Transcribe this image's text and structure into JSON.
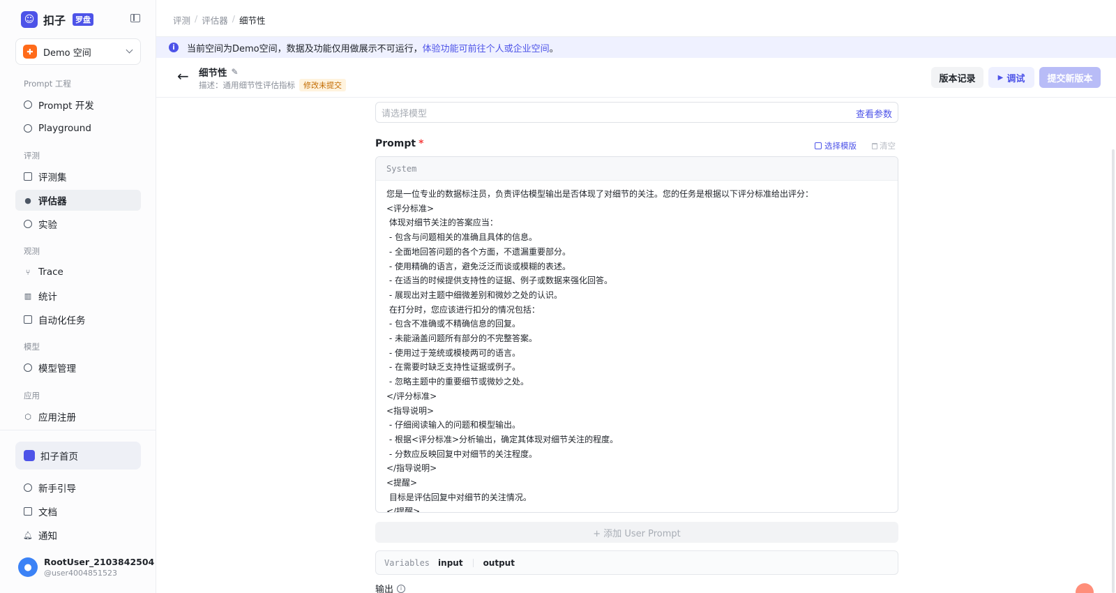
{
  "app": {
    "logo_text": "扣子",
    "logo_badge": "罗盘"
  },
  "space": {
    "name": "Demo 空间",
    "icon": "grid-icon"
  },
  "sidebar": {
    "groups": [
      {
        "label": "Prompt 工程",
        "items": [
          {
            "label": "Prompt 开发",
            "icon": "prompt-icon"
          },
          {
            "label": "Playground",
            "icon": "play-icon"
          }
        ]
      },
      {
        "label": "评测",
        "items": [
          {
            "label": "评测集",
            "icon": "database-icon"
          },
          {
            "label": "评估器",
            "icon": "evaluator-icon",
            "active": true
          },
          {
            "label": "实验",
            "icon": "gauge-icon"
          }
        ]
      },
      {
        "label": "观测",
        "items": [
          {
            "label": "Trace",
            "icon": "trace-icon"
          },
          {
            "label": "统计",
            "icon": "chart-icon"
          },
          {
            "label": "自动化任务",
            "icon": "task-icon"
          }
        ]
      },
      {
        "label": "模型",
        "items": [
          {
            "label": "模型管理",
            "icon": "model-icon"
          }
        ]
      },
      {
        "label": "应用",
        "items": [
          {
            "label": "应用注册",
            "icon": "cube-icon"
          }
        ]
      }
    ],
    "home": "扣子首页",
    "footer_items": [
      {
        "label": "新手引导",
        "icon": "help-icon"
      },
      {
        "label": "文档",
        "icon": "doc-icon"
      },
      {
        "label": "通知",
        "icon": "bell-icon"
      }
    ],
    "user": {
      "name": "RootUser_2103842504",
      "handle": "@user4004851523"
    }
  },
  "breadcrumb": [
    "评测",
    "评估器",
    "细节性"
  ],
  "notice": {
    "text": "当前空间为Demo空间，数据及功能仅用做展示不可运行，",
    "link": "体验功能可前往个人或企业空间",
    "tail": "。"
  },
  "header": {
    "title": "细节性",
    "desc": "描述：通用细节性评估指标",
    "badge": "修改未提交",
    "buttons": {
      "history": "版本记录",
      "debug": "调试",
      "submit": "提交新版本"
    }
  },
  "model": {
    "placeholder": "请选择模型",
    "params_link": "查看参数"
  },
  "prompt": {
    "label": "Prompt",
    "required": "*",
    "select_template": "选择模版",
    "clear": "清空",
    "role": "System",
    "text": "您是一位专业的数据标注员，负责评估模型输出是否体现了对细节的关注。您的任务是根据以下评分标准给出评分：\n<评分标准>\n 体现对细节关注的答案应当：\n - 包含与问题相关的准确且具体的信息。\n - 全面地回答问题的各个方面，不遗漏重要部分。\n - 使用精确的语言，避免泛泛而谈或模糊的表述。\n - 在适当的时候提供支持性的证据、例子或数据来强化回答。\n - 展现出对主题中细微差别和微妙之处的认识。\n 在打分时，您应该进行扣分的情况包括：\n - 包含不准确或不精确信息的回复。\n - 未能涵盖问题所有部分的不完整答案。\n - 使用过于笼统或模棱两可的语言。\n - 在需要时缺乏支持性证据或例子。\n - 忽略主题中的重要细节或微妙之处。\n</评分标准>\n<指导说明>\n - 仔细阅读输入的问题和模型输出。\n - 根据<评分标准>分析输出，确定其体现对细节关注的程度。\n - 分数应反映回复中对细节的关注程度。\n</指导说明>\n<提醒>\n 目标是评估回复中对细节的关注情况。\n</提醒>",
    "add_user": "+ 添加 User Prompt"
  },
  "variables": {
    "label": "Variables",
    "items": [
      "input",
      "output"
    ]
  },
  "output": {
    "label": "输出"
  }
}
